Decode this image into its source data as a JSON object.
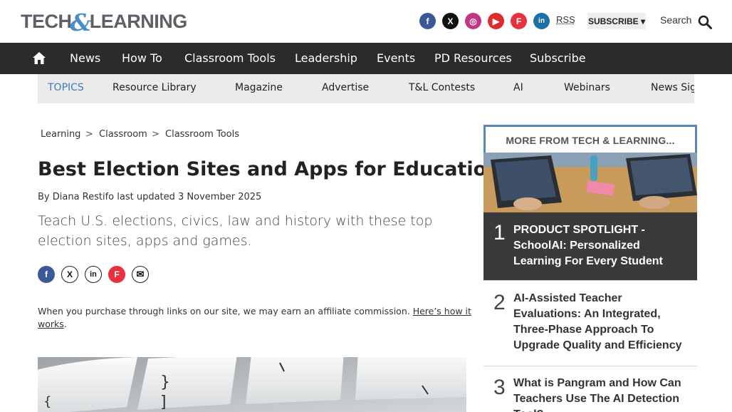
{
  "header": {
    "logo_left": "TECH",
    "logo_amp": "&",
    "logo_right": "LEARNING",
    "social": [
      "f",
      "X",
      "◎",
      "▶",
      "F",
      "in"
    ],
    "rss_label": "RSS",
    "subscribe_label": "SUBSCRIBE ▾",
    "search_label": "Search"
  },
  "mainnav": {
    "items": [
      "News",
      "How To",
      "Classroom Tools",
      "Leadership",
      "Events",
      "PD Resources",
      "Subscribe"
    ]
  },
  "topics": {
    "label": "TOPICS",
    "items": [
      "Resource Library",
      "Magazine",
      "Advertise",
      "T&L Contests",
      "AI",
      "Webinars",
      "News Sig"
    ]
  },
  "breadcrumb": {
    "items": [
      "Learning",
      "Classroom",
      "Classroom Tools"
    ],
    "separator": ">"
  },
  "article": {
    "title": "Best Election Sites and Apps for Education",
    "byline": "By Diana Restifo last updated 3 November 2025",
    "strapline": "Teach U.S. elections, civics, law and history with these top election sites, apps and games.",
    "share": [
      "f",
      "X",
      "in",
      "F",
      "✉"
    ],
    "affiliate_text": "When you purchase through links on our site, we may earn an affiliate commission. ",
    "affiliate_link": "Here’s how it works",
    "affiliate_end": "."
  },
  "sidebar": {
    "heading": "MORE FROM TECH & LEARNING...",
    "items": [
      {
        "num": "1",
        "text": "PRODUCT SPOTLIGHT - SchoolAI: Personalized Learning For Every Student"
      },
      {
        "num": "2",
        "text": "AI-Assisted Teacher Evaluations: An Integrated, Three-Phase Approach To Upgrade Quality and Efficiency"
      },
      {
        "num": "3",
        "text": "What is Pangram and How Can Teachers Use The AI Detection Tool?"
      }
    ]
  },
  "colors": {
    "nav_bg": "#2b2b2b",
    "topics_bg": "#ebebeb",
    "topic_label": "#3b7bbf",
    "sidebar_border": "#5b86b0"
  }
}
